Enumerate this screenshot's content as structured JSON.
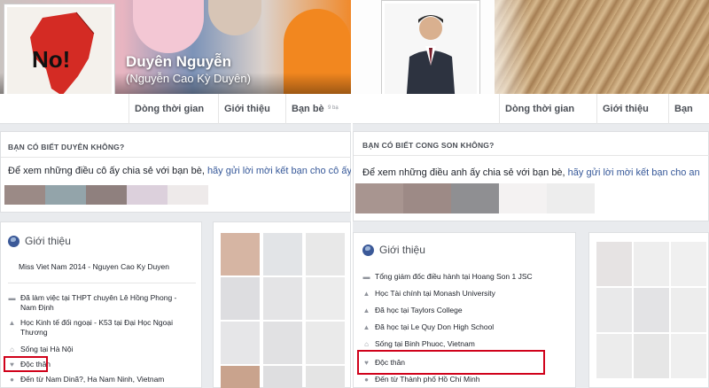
{
  "left": {
    "profile_name": "Duyên Nguyễn",
    "alt_name": "(Nguyễn Cao Kỳ Duyên)",
    "avatar_text": "No!",
    "tabs": [
      "Dòng thời gian",
      "Giới thiệu",
      "Bạn bè",
      "9 bạ"
    ],
    "know_title": "BẠN CÓ BIẾT DUYÊN KHÔNG?",
    "share_text": "Để xem những điều cô ấy chia sẻ với bạn bè,",
    "share_link": "hãy gửi lời mời kết bạn cho cô ấy.",
    "intro_title": "Giới thiệu",
    "headline": "Miss Viet Nam 2014 - Nguyen Cao Ky Duyen",
    "rows": [
      {
        "icon": "work-icon",
        "text": "Đã làm việc tại THPT chuyên Lê Hồng Phong - Nam Định"
      },
      {
        "icon": "study-icon",
        "text": "Học Kinh tế đối ngoại - K53 tại Đại Học Ngoại Thương"
      },
      {
        "icon": "home-icon",
        "text": "Sống tại Hà Nội"
      },
      {
        "icon": "heart-icon",
        "text": "Độc thân"
      },
      {
        "icon": "location-icon",
        "text": "Đến từ Nam Dinã?, Ha Nam Ninh, Vietnam"
      }
    ]
  },
  "right": {
    "tabs": [
      "Dòng thời gian",
      "Giới thiệu",
      "Bạn bè"
    ],
    "know_title": "BẠN CÓ BIẾT CONG SON KHÔNG?",
    "share_text": "Để xem những điều anh ấy chia sẻ với bạn bè,",
    "share_link": "hãy gửi lời mời kết bạn cho an",
    "intro_title": "Giới thiệu",
    "rows": [
      {
        "icon": "work-icon",
        "text": "Tổng giám đốc điều hành tại Hoang Son 1 JSC"
      },
      {
        "icon": "study-icon",
        "text": "Học Tài chính tại Monash University"
      },
      {
        "icon": "study-icon",
        "text": "Đã học tại Taylors College"
      },
      {
        "icon": "study-icon",
        "text": "Đã học tại Le Quy Don High School"
      },
      {
        "icon": "home-icon",
        "text": "Sống tại Binh Phuoc, Vietnam"
      },
      {
        "icon": "heart-icon",
        "text": "Độc thân"
      },
      {
        "icon": "location-icon",
        "text": "Đến từ Thành phố Hồ Chí Minh"
      }
    ]
  },
  "colors": {
    "fb_link": "#365899",
    "highlight": "#d0021b",
    "fb_blue": "#3b5998"
  }
}
